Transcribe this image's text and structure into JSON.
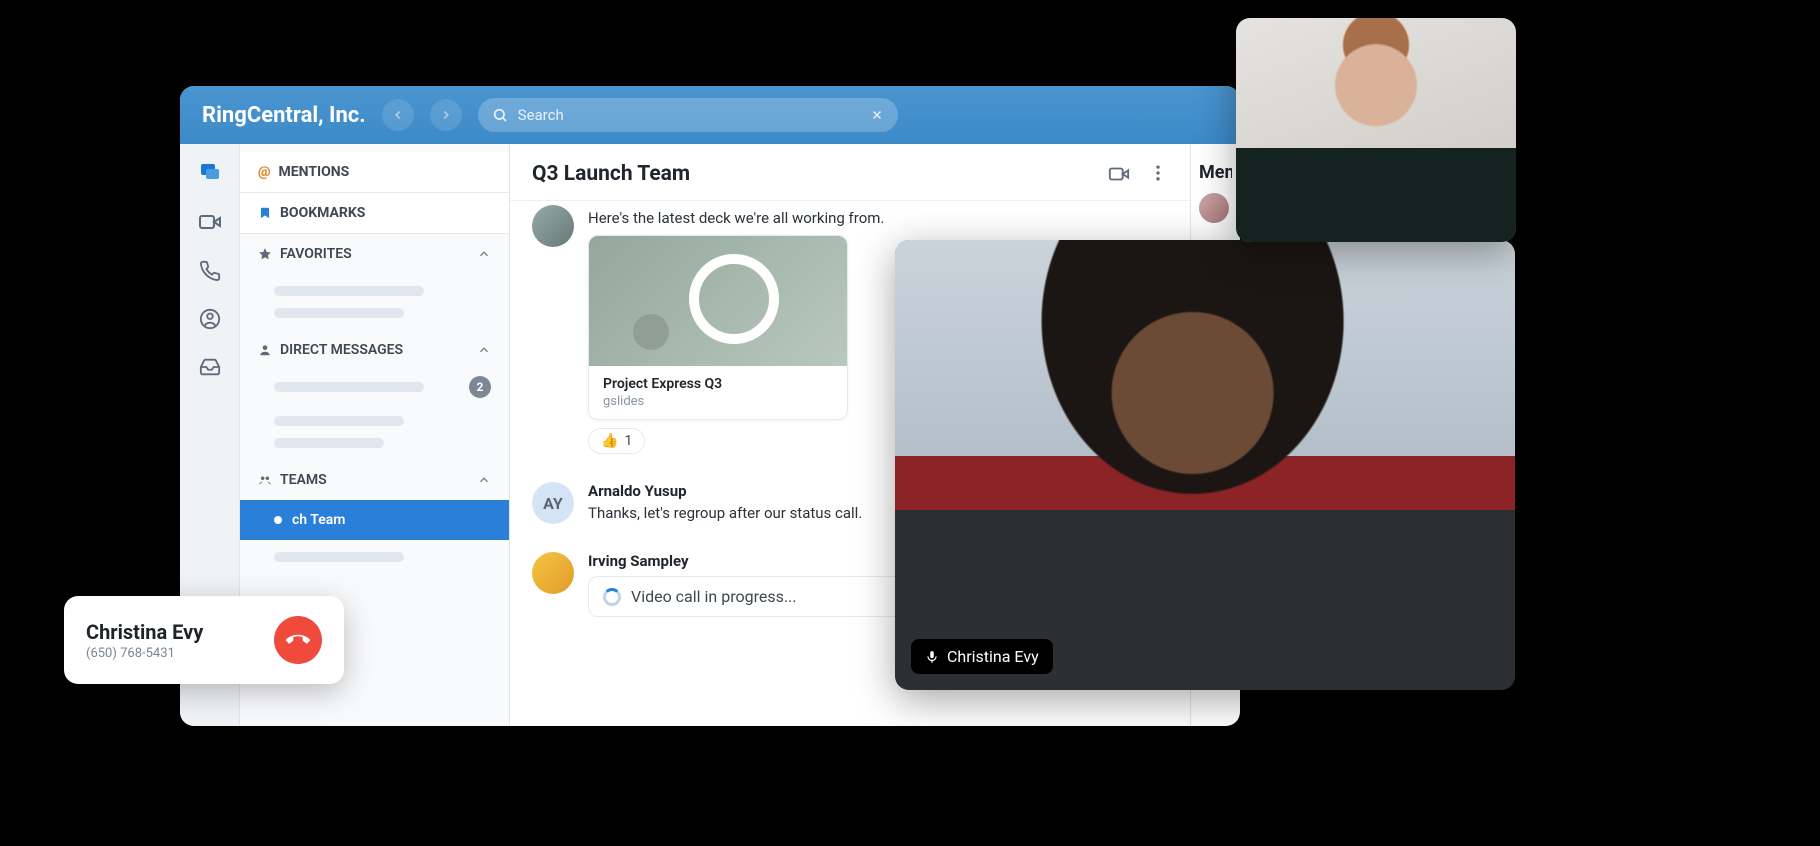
{
  "header": {
    "company": "RingCentral, Inc.",
    "search_placeholder": "Search"
  },
  "sidebar": {
    "mentions": "MENTIONS",
    "bookmarks": "BOOKMARKS",
    "favorites": "FAVORITES",
    "direct_messages": "DIRECT MESSAGES",
    "dm_badge": "2",
    "teams": "TEAMS",
    "active_team": "ch Team"
  },
  "main": {
    "title": "Q3 Launch Team",
    "msg1_text": "Here's the latest deck we're all working from.",
    "attachment_title": "Project Express Q3",
    "attachment_sub": "gslides",
    "reaction_emoji": "👍",
    "reaction_count": "1",
    "msg2_author": "Arnaldo Yusup",
    "msg2_initials": "AY",
    "msg2_text": "Thanks, let's regroup after our status call.",
    "msg3_author": "Irving Sampley",
    "progress_text": "Video call in progress..."
  },
  "right_panel": {
    "title": "Mem"
  },
  "call_toast": {
    "name": "Christina Evy",
    "number": "(650) 768-5431"
  },
  "video_large": {
    "name": "Christina Evy"
  }
}
